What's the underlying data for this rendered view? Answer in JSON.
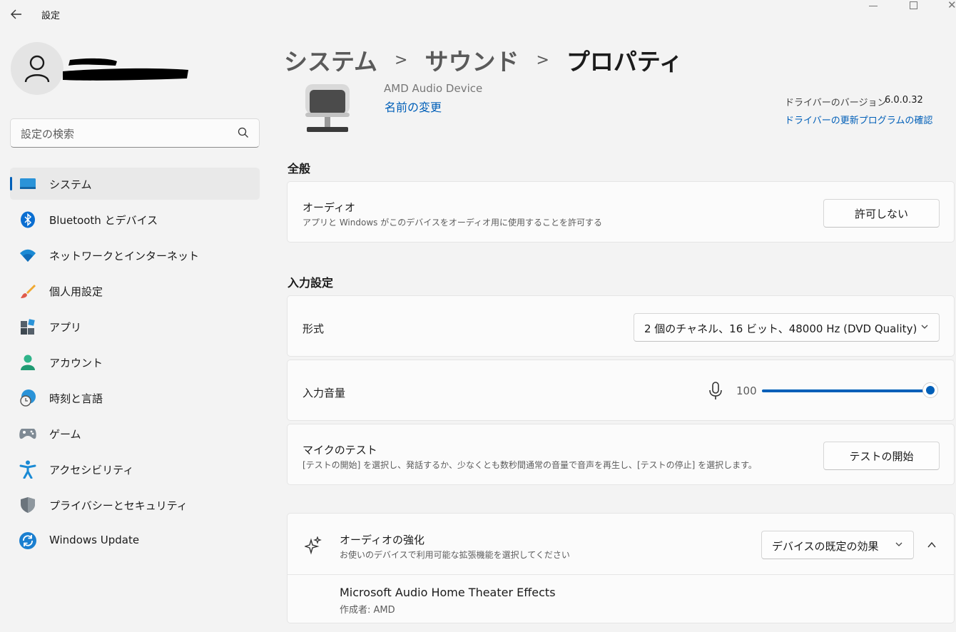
{
  "window": {
    "title": "設定"
  },
  "search": {
    "placeholder": "設定の検索"
  },
  "nav": [
    {
      "label": "システム",
      "icon": "system-icon",
      "active": true
    },
    {
      "label": "Bluetooth とデバイス",
      "icon": "bluetooth-icon"
    },
    {
      "label": "ネットワークとインターネット",
      "icon": "network-icon"
    },
    {
      "label": "個人用設定",
      "icon": "personalization-icon"
    },
    {
      "label": "アプリ",
      "icon": "apps-icon"
    },
    {
      "label": "アカウント",
      "icon": "account-icon"
    },
    {
      "label": "時刻と言語",
      "icon": "time-language-icon"
    },
    {
      "label": "ゲーム",
      "icon": "gaming-icon"
    },
    {
      "label": "アクセシビリティ",
      "icon": "accessibility-icon"
    },
    {
      "label": "プライバシーとセキュリティ",
      "icon": "privacy-icon"
    },
    {
      "label": "Windows Update",
      "icon": "windows-update-icon"
    }
  ],
  "breadcrumb": {
    "item1": "システム",
    "item2": "サウンド",
    "current": "プロパティ"
  },
  "device": {
    "name": "AMD Audio Device",
    "rename_link": "名前の変更",
    "driver_version_label": "ドライバーのバージョン",
    "driver_version": "6.0.0.32",
    "driver_update_link": "ドライバーの更新プログラムの確認"
  },
  "general": {
    "section_title": "全般",
    "audio_title": "オーディオ",
    "audio_desc": "アプリと Windows がこのデバイスをオーディオ用に使用することを許可する",
    "audio_button": "許可しない"
  },
  "input": {
    "section_title": "入力設定",
    "format_label": "形式",
    "format_value": "2 個のチャネル、16 ビット、48000 Hz (DVD Quality)",
    "volume_label": "入力音量",
    "volume_value": "100",
    "volume_level": 100,
    "mic_test_title": "マイクのテスト",
    "mic_test_desc": "[テストの開始] を選択し、発話するか、少なくとも数秒間通常の音量で音声を再生し、[テストの停止] を選択します。",
    "mic_test_button": "テストの開始"
  },
  "enhancement": {
    "title": "オーディオの強化",
    "desc": "お使いのデバイスで利用可能な拡張機能を選択してください",
    "dropdown_value": "デバイスの既定の効果",
    "effect_name": "Microsoft Audio Home Theater Effects",
    "effect_author": "作成者: AMD"
  },
  "colors": {
    "accent": "#005fb8",
    "background": "#f3f3f3",
    "card": "#fbfbfb"
  }
}
